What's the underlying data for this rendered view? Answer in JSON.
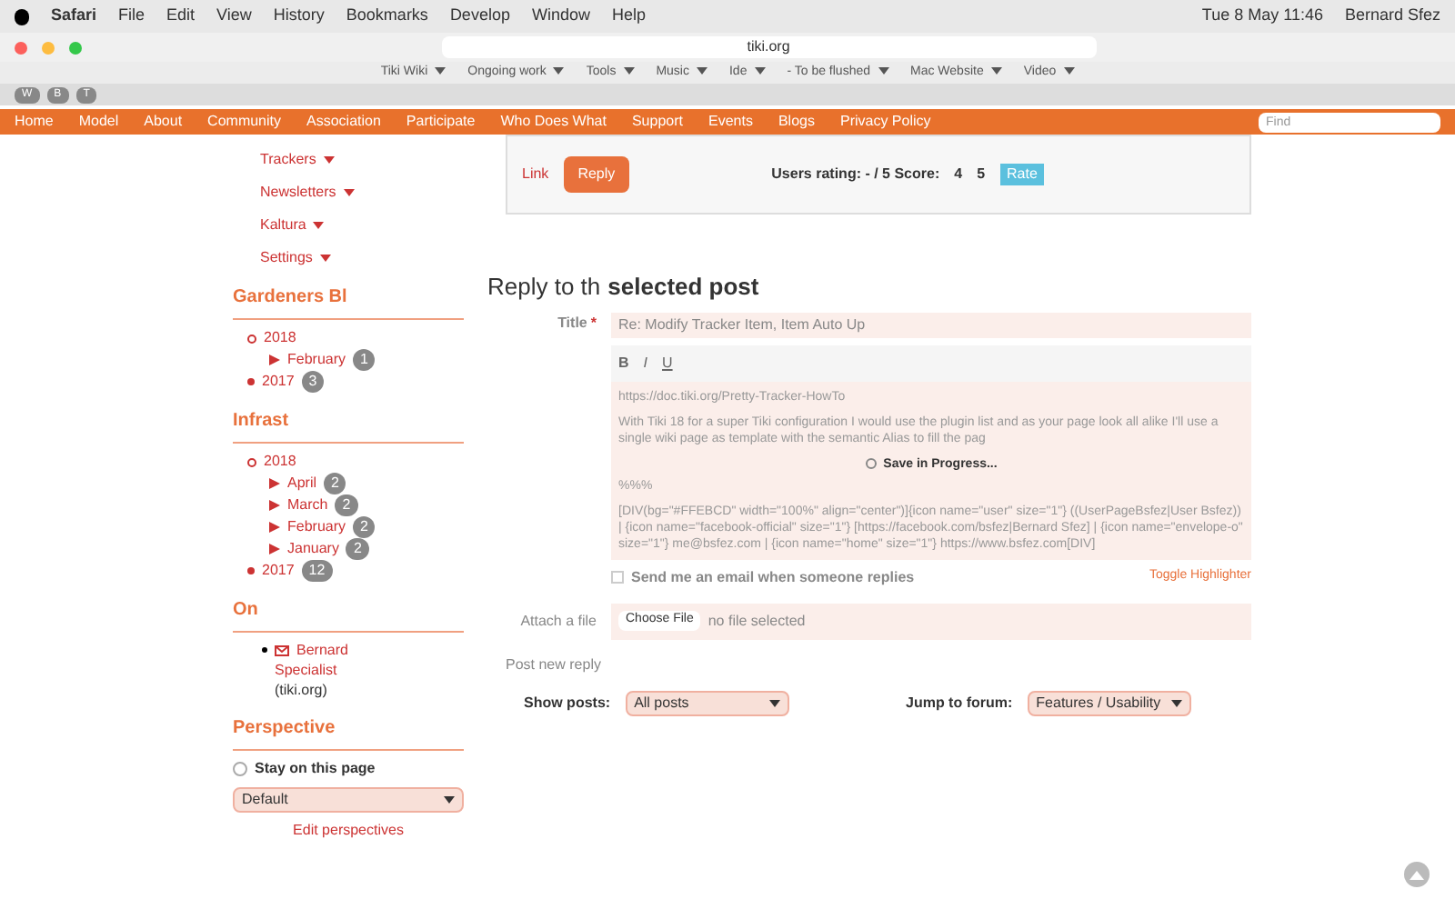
{
  "menubar": {
    "items": [
      "Safari",
      "File",
      "Edit",
      "View",
      "History",
      "Bookmarks",
      "Develop",
      "Window",
      "Help"
    ],
    "clock": "Tue 8 May  11:46",
    "user": "Bernard Sfez"
  },
  "browser": {
    "address": "tiki.org",
    "bookmarks": [
      "Tiki Wiki",
      "Ongoing work",
      "Tools",
      "Music",
      "Ide",
      "- To be flushed",
      "Mac Website",
      "Video"
    ],
    "tab_buttons": [
      "W",
      "B",
      "T"
    ]
  },
  "nav": {
    "items": [
      "Home",
      "Model",
      "About",
      "Community",
      "Association",
      "Participate",
      "Who Does What",
      "Support",
      "Events",
      "Blogs",
      "Privacy Policy"
    ],
    "search": {
      "placeholder": "Find"
    }
  },
  "sidebar": {
    "menu": [
      "Trackers",
      "Newsletters",
      "Kaltura",
      "Settings"
    ],
    "modules": [
      {
        "title": "Gardeners Bl",
        "years": [
          {
            "label": "2018",
            "expanded": true,
            "months": [
              {
                "label": "February",
                "count": "1"
              }
            ]
          },
          {
            "label": "2017",
            "expanded": false,
            "count": "3"
          }
        ]
      },
      {
        "title": "Infrast",
        "years": [
          {
            "label": "2018",
            "expanded": true,
            "months": [
              {
                "label": "April",
                "count": "2"
              },
              {
                "label": "March",
                "count": "2"
              },
              {
                "label": "February",
                "count": "2"
              },
              {
                "label": "January",
                "count": "2"
              }
            ]
          },
          {
            "label": "2017",
            "expanded": false,
            "count": "12"
          }
        ]
      }
    ],
    "online": {
      "title": "On",
      "users": [
        {
          "name": "Bernard",
          "role": "Specialist",
          "site": "(tiki.org)"
        }
      ]
    },
    "perspective": {
      "title": "Perspective",
      "stay": {
        "label": "Stay on this page",
        "checked": false
      },
      "select": "Default",
      "link": "Edit perspectives"
    }
  },
  "post_footer": {
    "link": "Link",
    "reply": "Reply",
    "rating": "Users rating: - / 5 Score:",
    "options": [
      "4",
      "5"
    ],
    "rate": "Rate"
  },
  "reply_form": {
    "heading": "Reply to th",
    "heading_end": "selected post",
    "title_label": "Title",
    "required_mark": "*",
    "title_value": "Re: Modify Tracker Item, Item Auto Up",
    "toolbar": [
      "B",
      "I",
      "U"
    ],
    "body_lines": [
      "https://doc.tiki.org/Pretty-Tracker-HowTo",
      "With Tiki 18 for a super Tiki configuration I would use the plugin list and as your page look all alike I'll use a single wiki page as template with the semantic Alias to fill the pag",
      "%%%",
      "[DIV(bg=\"#FFEBCD\" width=\"100%\" align=\"center\")]{icon name=\"user\" size=\"1\"} ((UserPageBsfez|User Bsfez)) | {icon name=\"facebook-official\" size=\"1\"} [https://facebook.com/bsfez|Bernard Sfez] | {icon name=\"envelope-o\" size=\"1\"} me@bsfez.com | {icon name=\"home\" size=\"1\"} https://www.bsfez.com[DIV]"
    ],
    "saving": "Save in Progress...",
    "notify": {
      "label": "Send me an email when someone replies",
      "checked": false
    },
    "toggle": "Toggle Highlighter",
    "attach_label": "Attach a file",
    "choose": "Choose File",
    "no_file": "no file selected",
    "post_label": "Post new reply"
  },
  "filters": [
    {
      "label": "Show posts:",
      "value": "All posts"
    },
    {
      "label": "Jump to forum:",
      "value": "Features / Usability"
    }
  ]
}
